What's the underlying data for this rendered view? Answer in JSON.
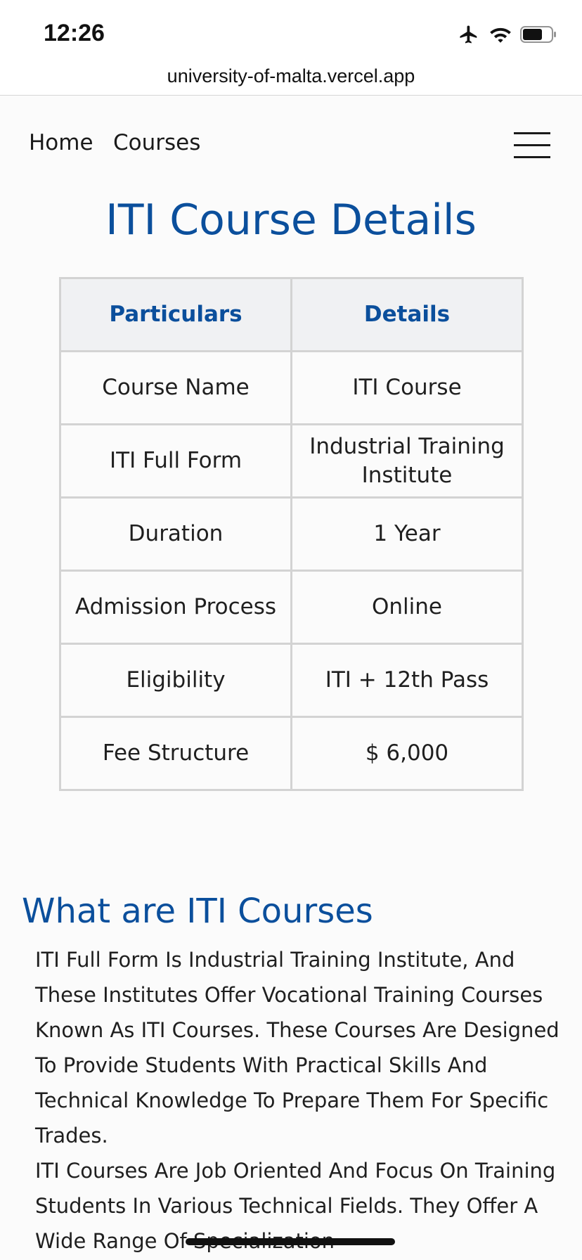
{
  "status": {
    "time": "12:26"
  },
  "browser": {
    "url": "university-of-malta.vercel.app"
  },
  "nav": {
    "home": "Home",
    "courses": "Courses"
  },
  "page": {
    "title": "ITI Course Details"
  },
  "table": {
    "headers": [
      "Particulars",
      "Details"
    ],
    "rows": [
      [
        "Course Name",
        "ITI Course"
      ],
      [
        "ITI Full Form",
        "Industrial Training Institute"
      ],
      [
        "Duration",
        "1 Year"
      ],
      [
        "Admission Process",
        "Online"
      ],
      [
        "Eligibility",
        "ITI + 12th Pass"
      ],
      [
        "Fee Structure",
        "$ 6,000"
      ]
    ]
  },
  "section": {
    "heading": "What are ITI Courses",
    "paragraph1": "ITI Full Form Is Industrial Training Institute, And These Institutes Offer Vocational Training Courses Known As ITI Courses. These Courses Are Designed To Provide Students With Practical Skills And Technical Knowledge To Prepare Them For Specific Trades.",
    "paragraph2": "ITI Courses Are Job Oriented And Focus On Training Students In Various Technical Fields. They Offer A Wide Range Of Specialization"
  },
  "colors": {
    "accent": "#0b4f9c",
    "table_header_bg": "#f0f1f3",
    "table_border": "#d3d3d3",
    "page_bg": "#fbfbfb"
  },
  "icons": {
    "status": [
      "airplane-icon",
      "wifi-icon",
      "battery-icon"
    ],
    "menu": "hamburger-menu-icon"
  }
}
